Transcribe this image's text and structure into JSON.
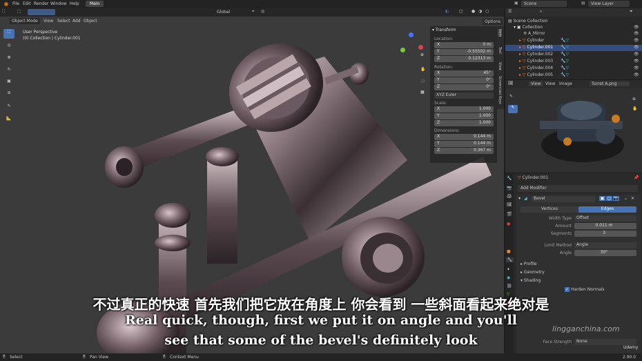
{
  "menubar": {
    "items": [
      "File",
      "Edit",
      "Render",
      "Window",
      "Help"
    ],
    "workspace_tab": "Main",
    "scene": "Scene",
    "view_layer": "View Layer"
  },
  "viewport_header": {
    "mode": "Object Mode",
    "menus": [
      "View",
      "Select",
      "Add",
      "Object"
    ],
    "orientation": "Global",
    "options": "Options"
  },
  "viewport": {
    "perspective": "User Perspective",
    "collection_info": "(0) Collection | Cylinder.001"
  },
  "n_panel": {
    "section": "Transform",
    "location_label": "Location:",
    "location": [
      {
        "axis": "X",
        "value": "0 m"
      },
      {
        "axis": "Y",
        "value": "-0.55502 m"
      },
      {
        "axis": "Z",
        "value": "0.12313 m"
      }
    ],
    "rotation_label": "Rotation:",
    "rotation": [
      {
        "axis": "X",
        "value": "45°"
      },
      {
        "axis": "Y",
        "value": "0°"
      },
      {
        "axis": "Z",
        "value": "0°"
      }
    ],
    "rotation_mode": "XYZ Euler",
    "scale_label": "Scale:",
    "scale": [
      {
        "axis": "X",
        "value": "1.000"
      },
      {
        "axis": "Y",
        "value": "1.000"
      },
      {
        "axis": "Z",
        "value": "1.000"
      }
    ],
    "dimensions_label": "Dimensions:",
    "dimensions": [
      {
        "axis": "X",
        "value": "0.144 m"
      },
      {
        "axis": "Y",
        "value": "0.144 m"
      },
      {
        "axis": "Z",
        "value": "0.367 m"
      }
    ],
    "tabs": [
      "Item",
      "Tool",
      "View",
      "Screencast Keys"
    ]
  },
  "outliner": {
    "scene_collection": "Scene Collection",
    "collection": "Collection",
    "items": [
      "A_Mirror",
      "Cylinder",
      "Cylinder.001",
      "Cylinder.002",
      "Cylinder.003",
      "Cylinder.004",
      "Cylinder.005"
    ],
    "selected": "Cylinder.001"
  },
  "image_editor": {
    "menus": [
      "View",
      "View",
      "Image"
    ],
    "image_name": "Turret A.png"
  },
  "properties": {
    "object_name": "Cylinder.001",
    "add_modifier": "Add Modifier",
    "modifier_name": "Bevel",
    "tabs": [
      "Vertices",
      "Edges"
    ],
    "active_tab": "Edges",
    "width_type_label": "Width Type",
    "width_type": "Offset",
    "amount_label": "Amount",
    "amount": "0.011 m",
    "segments_label": "Segments",
    "segments": "3",
    "limit_method_label": "Limit Method",
    "limit_method": "Angle",
    "angle_label": "Angle",
    "angle": "30°",
    "sections": [
      "Profile",
      "Geometry",
      "Shading"
    ],
    "harden_normals": "Harden Normals",
    "face_strength_label": "Face Strength",
    "face_strength": "None"
  },
  "statusbar": {
    "items": [
      "Select",
      "Pan View",
      "Context Menu"
    ],
    "version": "2.90.0"
  },
  "subtitles": {
    "chinese": "不过真正的快速 首先我们把它放在角度上 你会看到 一些斜面看起来绝对是",
    "english_line1": "Real quick, though, first we put it on angle and you'll",
    "english_line2": "see that some of the bevel's definitely look"
  },
  "watermark": {
    "site": "lingganchina.com",
    "brand": "Udemy"
  },
  "colors": {
    "accent_blue": "#4772b3",
    "selected_row": "#334d80",
    "header_bg": "#2b2b2b",
    "viewport_bg": "#3a3a3a"
  }
}
